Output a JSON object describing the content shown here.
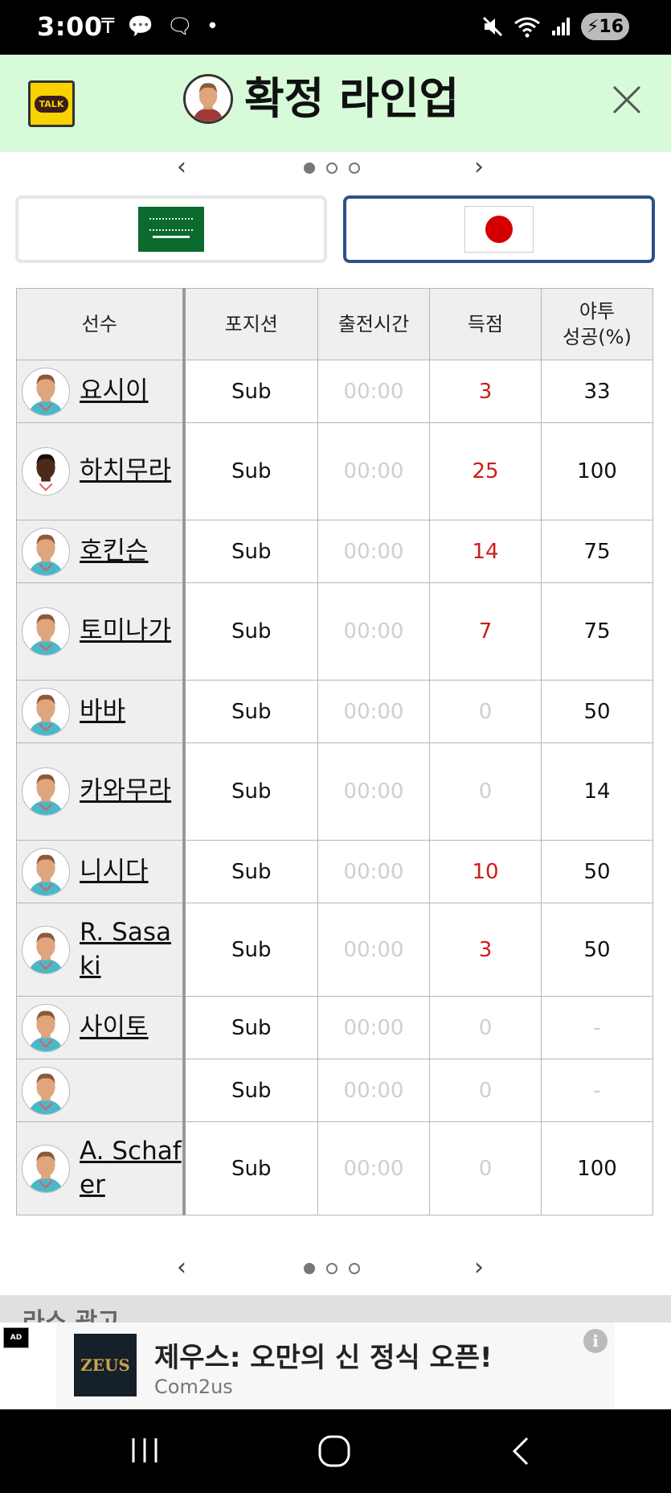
{
  "status_bar": {
    "time": "3:00",
    "left_icons": [
      "T-icon",
      "talk-icon",
      "chat-icon",
      "dot-icon"
    ],
    "battery": "16"
  },
  "header": {
    "title": "확정 라인업",
    "talk_label": "TALK"
  },
  "pager": {
    "prev": "‹",
    "next": "›",
    "total_pages": 3,
    "active_page": 1
  },
  "teams": [
    {
      "name": "Saudi Arabia",
      "flag": "saudi-flag",
      "selected": false
    },
    {
      "name": "Japan",
      "flag": "japan-flag",
      "selected": true
    }
  ],
  "table": {
    "headers": {
      "player": "선수",
      "position": "포지션",
      "time": "출전시간",
      "score": "득점",
      "fg_line1": "야투",
      "fg_line2": "성공(%)"
    },
    "rows": [
      {
        "name": "요시이",
        "position": "Sub",
        "time": "00:00",
        "score": "3",
        "fg": "33",
        "skin": "light"
      },
      {
        "name": "하치무라",
        "position": "Sub",
        "time": "00:00",
        "score": "25",
        "fg": "100",
        "skin": "dark"
      },
      {
        "name": "호킨슨",
        "position": "Sub",
        "time": "00:00",
        "score": "14",
        "fg": "75",
        "skin": "light"
      },
      {
        "name": "토미나가",
        "position": "Sub",
        "time": "00:00",
        "score": "7",
        "fg": "75",
        "skin": "light"
      },
      {
        "name": "바바",
        "position": "Sub",
        "time": "00:00",
        "score": "0",
        "fg": "50",
        "skin": "light"
      },
      {
        "name": "카와무라",
        "position": "Sub",
        "time": "00:00",
        "score": "0",
        "fg": "14",
        "skin": "light"
      },
      {
        "name": "니시다",
        "position": "Sub",
        "time": "00:00",
        "score": "10",
        "fg": "50",
        "skin": "light"
      },
      {
        "name": "R. Sasaki",
        "position": "Sub",
        "time": "00:00",
        "score": "3",
        "fg": "50",
        "skin": "light"
      },
      {
        "name": "사이토",
        "position": "Sub",
        "time": "00:00",
        "score": "0",
        "fg": "-",
        "skin": "light"
      },
      {
        "name": "",
        "position": "Sub",
        "time": "00:00",
        "score": "0",
        "fg": "-",
        "skin": "light"
      },
      {
        "name": "A. Schafer",
        "position": "Sub",
        "time": "00:00",
        "score": "0",
        "fg": "100",
        "skin": "light"
      }
    ]
  },
  "band_text": "라스 광고",
  "ad": {
    "badge": "AD",
    "logo_text": "ZEUS",
    "title": "제우스: 오만의 신 정식 오픈!",
    "subtitle": "Com2us",
    "info": "i"
  },
  "colors": {
    "header_bg": "#d7fbd9",
    "selected_tab_border": "#2e4f8a",
    "score_red": "#d21a1a"
  }
}
